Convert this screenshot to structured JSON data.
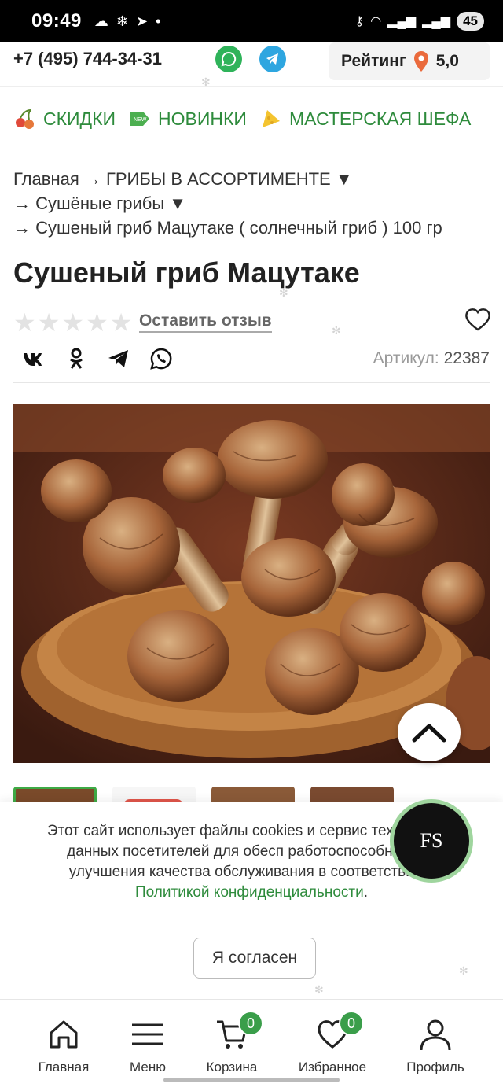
{
  "status": {
    "time": "09:49",
    "battery": "45"
  },
  "header": {
    "phone": "+7 (495) 744-34-31",
    "rating_label": "Рейтинг",
    "rating_value": "5,0"
  },
  "categories": [
    {
      "label": "СКИДКИ",
      "icon": "cherry-icon"
    },
    {
      "label": "НОВИНКИ",
      "icon": "new-tag-icon"
    },
    {
      "label": "МАСТЕРСКАЯ ШЕФА",
      "icon": "cheese-icon"
    }
  ],
  "breadcrumb": {
    "line1": "Главная → ГРИБЫ В АССОРТИМЕНТЕ ▼",
    "line2": "→ Сушёные грибы ▼",
    "line3": "→ Сушеный гриб Мацутаке ( солнечный гриб ) 100 гр"
  },
  "product": {
    "title": "Сушеный гриб Мацутаке",
    "rating_stars": 0,
    "review_link": "Оставить отзыв",
    "sku_label": "Артикул:",
    "sku_value": "22387"
  },
  "cookie": {
    "text": "Этот сайт использует файлы cookies и сервис технических данных посетителей для обесп работоспособности и улучшения качества обслуживания в соответствии с ",
    "link": "Политикой конфиденциальности",
    "tail": ".",
    "button": "Я согласен"
  },
  "fs_label": "FS",
  "nav": {
    "home": "Главная",
    "menu": "Меню",
    "cart": "Корзина",
    "cart_count": "0",
    "favorites": "Избранное",
    "favorites_count": "0",
    "profile": "Профиль"
  },
  "colors": {
    "accent": "#2e8b3c",
    "badge": "#3a9e4a"
  }
}
